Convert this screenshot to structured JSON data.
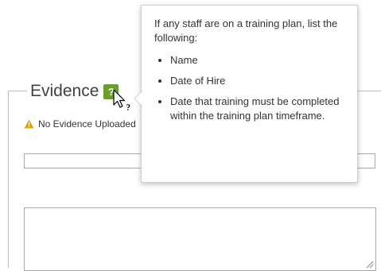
{
  "evidence": {
    "title": "Evidence",
    "help_icon_label": "?",
    "warning_text": "No Evidence Uploaded",
    "warning_color": "#e6a100",
    "help_icon_color": "#6c9e2e"
  },
  "tooltip": {
    "intro": "If any staff are on a training plan, list the following:",
    "items": [
      "Name",
      "Date of Hire",
      "Date that training must be completed within the training plan timeframe."
    ]
  },
  "inputs": {
    "text_value": "",
    "textarea_value": ""
  },
  "icons": {
    "help": "question-icon",
    "warning": "warning-triangle-icon",
    "cursor": "help-cursor-icon",
    "resize": "resize-grip-icon"
  }
}
